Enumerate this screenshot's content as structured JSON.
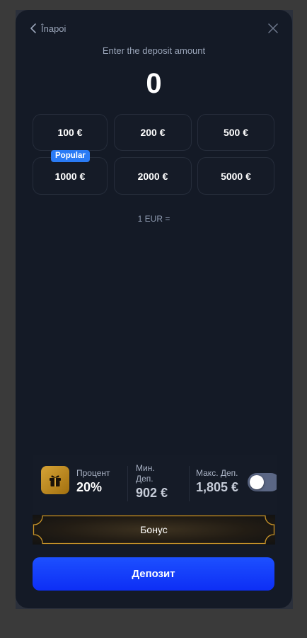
{
  "header": {
    "back_label": "Înapoi"
  },
  "subtitle": "Enter the deposit amount",
  "amount": "0",
  "presets": [
    "100 €",
    "200 €",
    "500 €",
    "1000 €",
    "2000 €",
    "5000 €"
  ],
  "popular_badge": "Popular",
  "rate": "1 EUR =",
  "bonus_info": {
    "percent_label": "Процент",
    "percent_value": "20%",
    "min_label_line1": "Мин.",
    "min_label_line2": "Деп.",
    "min_value": "902 €",
    "max_label": "Макс. Деп.",
    "max_value": "1,805 €",
    "toggle_on": false
  },
  "bonus_button": "Бонус",
  "deposit_button": "Депозит",
  "colors": {
    "background": "#141a26",
    "accent": "#1d50ff",
    "badge": "#2a7bf5",
    "gold": "#c8942a"
  },
  "icons": [
    "chevron-left-icon",
    "close-icon",
    "gift-icon"
  ]
}
